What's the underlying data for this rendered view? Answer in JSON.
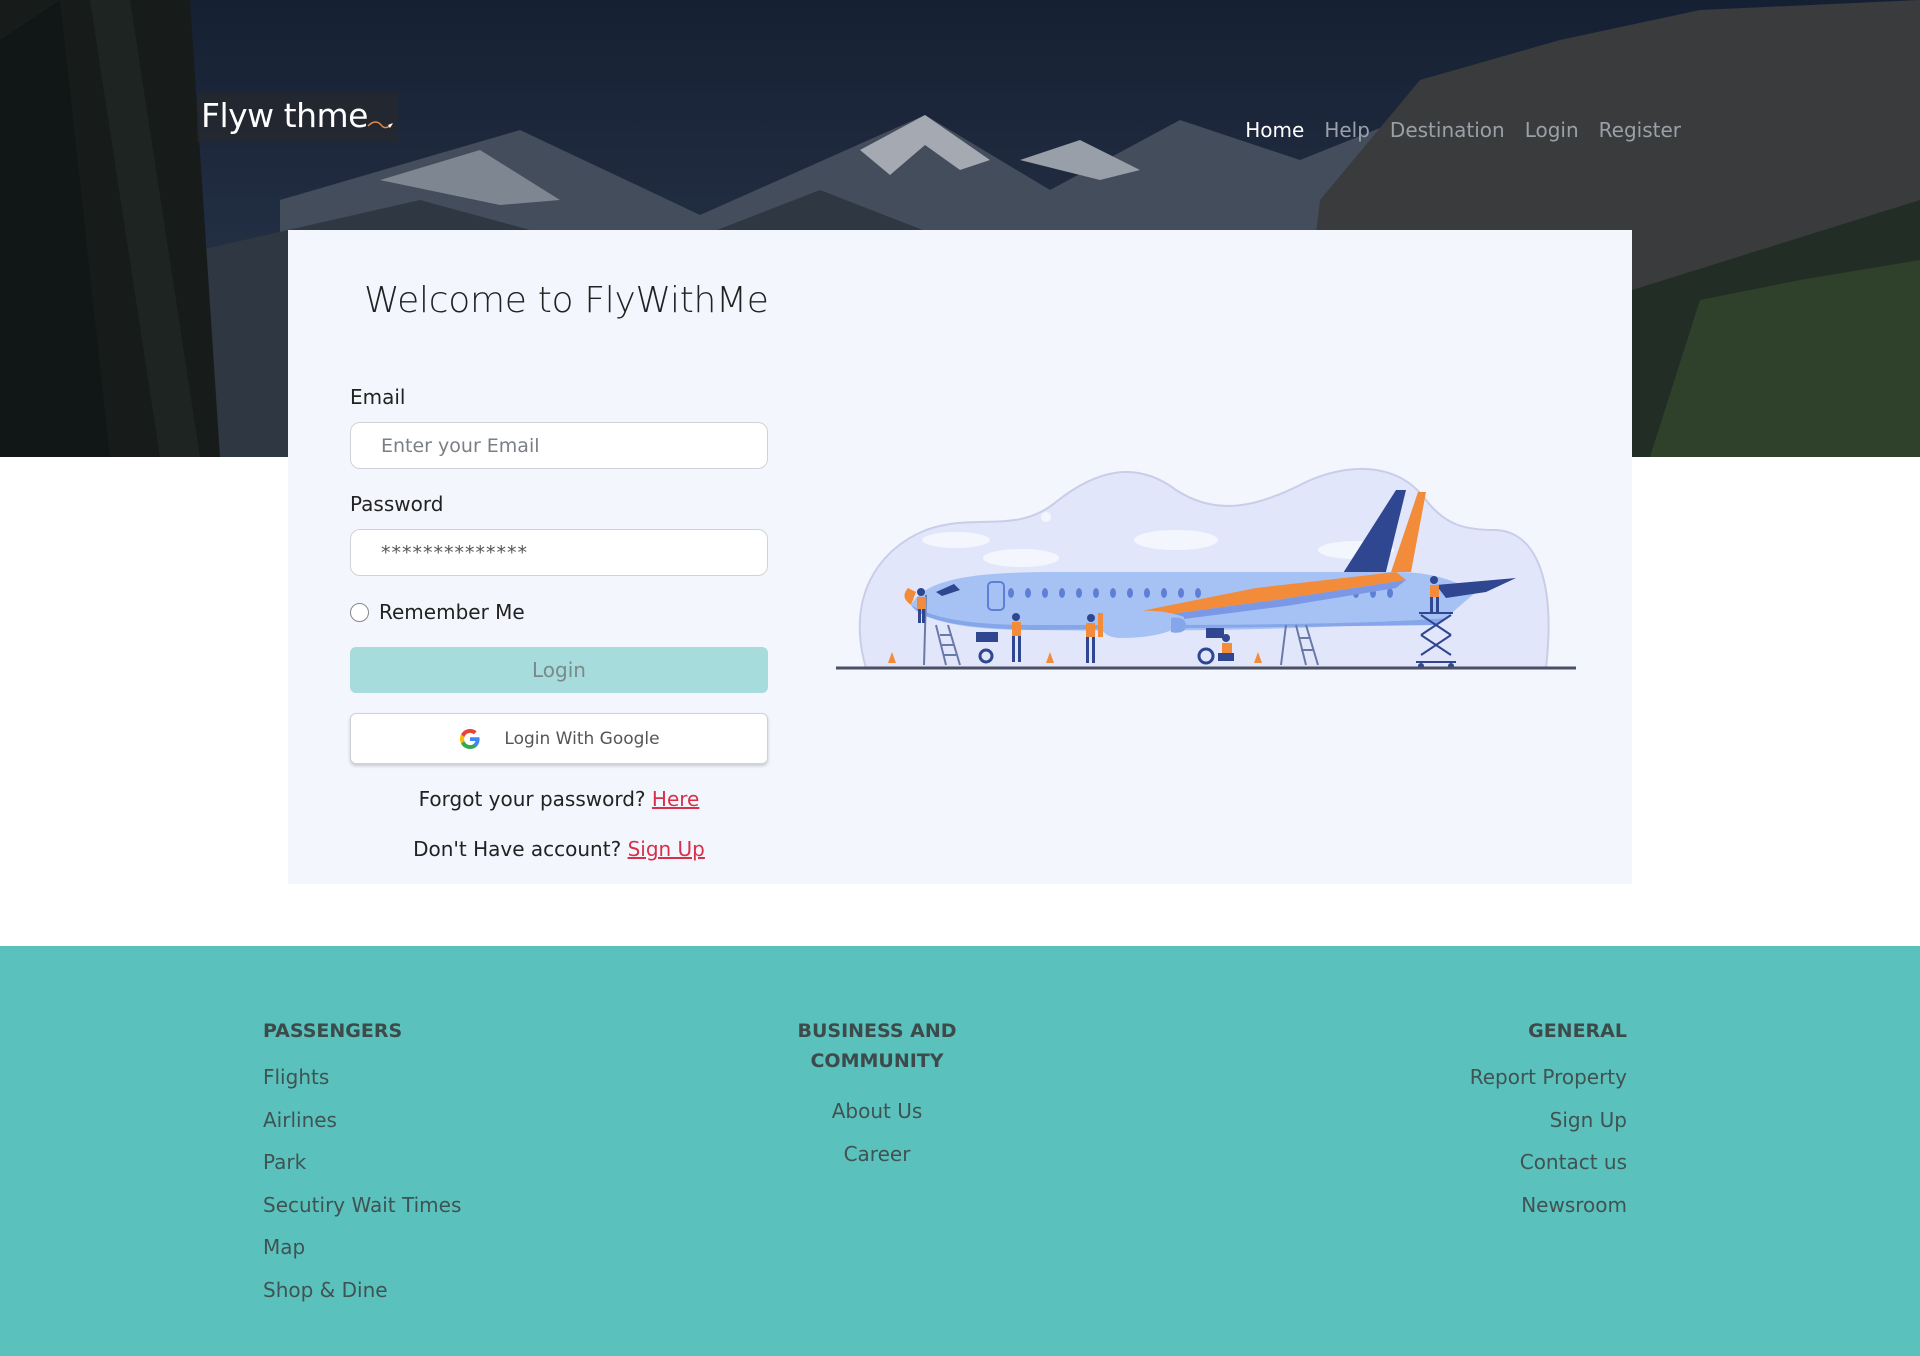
{
  "header": {
    "logo_text": "Flyw thme",
    "nav": [
      {
        "label": "Home",
        "active": true
      },
      {
        "label": "Help",
        "active": false
      },
      {
        "label": "Destination",
        "active": false
      },
      {
        "label": "Login",
        "active": false
      },
      {
        "label": "Register",
        "active": false
      }
    ]
  },
  "login_card": {
    "title": "Welcome to FlyWithMe",
    "email_label": "Email",
    "email_placeholder": "Enter your Email",
    "password_label": "Password",
    "password_value": "**************",
    "remember_label": "Remember Me",
    "login_button": "Login",
    "google_button": "Login With Google",
    "forgot_text": "Forgot your password?",
    "forgot_link": "Here",
    "signup_text": "Don't Have account?",
    "signup_link": "Sign Up"
  },
  "footer": {
    "passengers": {
      "heading": "PASSENGERS",
      "items": [
        "Flights",
        "Airlines",
        "Park",
        "Secutiry Wait Times",
        "Map",
        "Shop & Dine"
      ]
    },
    "business": {
      "heading_line1": "BUSINESS AND",
      "heading_line2": "COMMUNITY",
      "items": [
        "About Us",
        "Career"
      ]
    },
    "general": {
      "heading": "GENERAL",
      "items": [
        "Report Property",
        "Sign Up",
        "Contact us",
        "Newsroom"
      ]
    }
  },
  "colors": {
    "footer_bg": "#5bc1bd",
    "login_button_bg": "#a7dcdc",
    "link_red": "#d6304b",
    "card_bg": "#f4f6fd",
    "plane_orange": "#f28c3a",
    "plane_blue": "#9ab8f2"
  }
}
